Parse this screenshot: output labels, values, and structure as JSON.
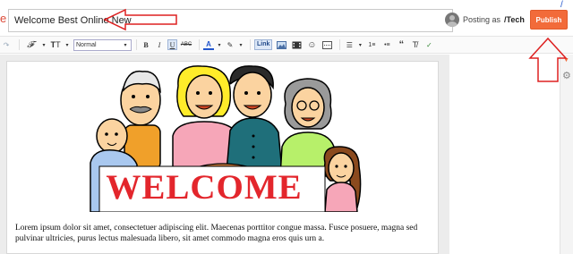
{
  "colors": {
    "accent": "#f26b3a",
    "annotation_red": "#dd2020",
    "welcome_red": "#e3262c",
    "link_blue": "#224a8a"
  },
  "header": {
    "edge_glyph": "e",
    "post_title": "Welcome Best Online New",
    "posting_as_label": "Posting as",
    "author_name": "/Tech",
    "publish_label": "Publish",
    "edge_slash": "/"
  },
  "toolbar": {
    "font_style": "Normal",
    "link_label": "Link",
    "icons": [
      "undo-icon",
      "font-family-icon",
      "font-size-icon",
      "format-select",
      "bold-icon",
      "italic-icon",
      "underline-icon",
      "strikethrough-icon",
      "text-color-icon",
      "highlight-icon",
      "link-button",
      "image-icon",
      "video-icon",
      "jump-break-icon",
      "align-icon",
      "numbered-list-icon",
      "bulleted-list-icon",
      "quote-icon",
      "clear-format-icon",
      "spellcheck-icon"
    ],
    "strike_label": "ABC",
    "bold_label": "B",
    "italic_label": "I",
    "underline_label": "U"
  },
  "content": {
    "banner_word": "WELCOME",
    "body_text": "Lorem ipsum dolor sit amet, consectetuer adipiscing elit. Maecenas porttitor congue massa. Fusce posuere, magna sed pulvinar ultricies, purus lectus malesuada libero, sit amet commodo magna eros quis urn a."
  }
}
